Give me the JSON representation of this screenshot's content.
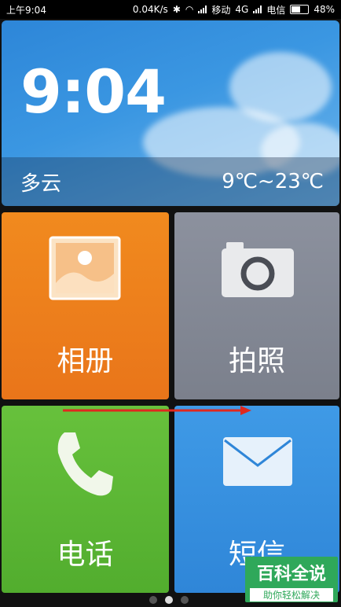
{
  "status_bar": {
    "time": "上午9:04",
    "net_speed": "0.04K/s",
    "carrier1": "移动",
    "net_type": "4G",
    "carrier2": "电信",
    "battery": "48%",
    "battery_level": 0.48
  },
  "weather": {
    "time": "9:04",
    "condition": "多云",
    "temp_range": "9℃~23℃"
  },
  "tiles": [
    {
      "label": "相册",
      "icon": "photo-album-icon",
      "color": "#ee801d"
    },
    {
      "label": "拍照",
      "icon": "camera-icon",
      "color": "#858a96"
    },
    {
      "label": "电话",
      "icon": "phone-icon",
      "color": "#5db835"
    },
    {
      "label": "短信",
      "icon": "envelope-icon",
      "color": "#3790df"
    }
  ],
  "watermark": {
    "title": "百科全说",
    "subtitle": "助你轻松解决"
  },
  "pager": {
    "pages": 3,
    "active": 2
  }
}
